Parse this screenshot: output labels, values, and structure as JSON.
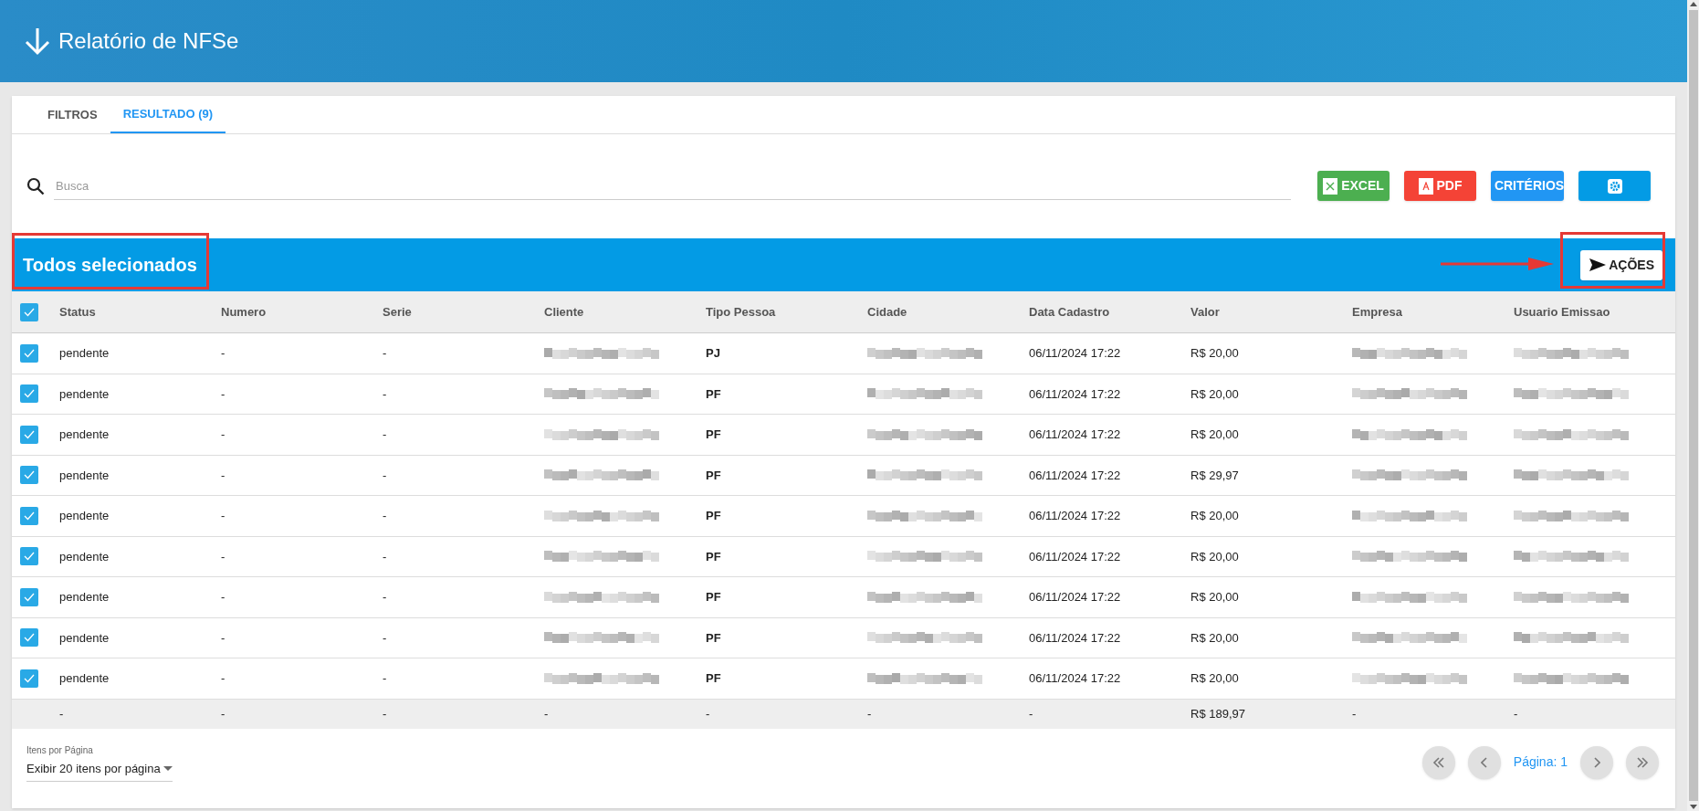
{
  "header": {
    "title": "Relatório de NFSe"
  },
  "tabs": [
    {
      "label": "FILTROS",
      "selected": false
    },
    {
      "label": "RESULTADO (9)",
      "selected": true
    }
  ],
  "search": {
    "placeholder": "Busca"
  },
  "toolbar": [
    {
      "kind": "excel",
      "label": "EXCEL"
    },
    {
      "kind": "pdf",
      "label": "PDF"
    },
    {
      "kind": "criteria",
      "label": "CRITÉRIOS"
    },
    {
      "kind": "settings"
    }
  ],
  "selection_bar": {
    "title": "Todos selecionados",
    "action": "AÇÕES"
  },
  "table": {
    "all_checked": true,
    "columns": [
      "Status",
      "Numero",
      "Serie",
      "Cliente",
      "Tipo Pessoa",
      "Cidade",
      "Data Cadastro",
      "Valor",
      "Empresa",
      "Usuario Emissao"
    ],
    "rows": [
      {
        "checked": true,
        "status": "pendente",
        "numero": "-",
        "serie": "-",
        "tipo": "PJ",
        "data": "06/11/2024 17:22",
        "valor": "R$ 20,00"
      },
      {
        "checked": true,
        "status": "pendente",
        "numero": "-",
        "serie": "-",
        "tipo": "PF",
        "data": "06/11/2024 17:22",
        "valor": "R$ 20,00"
      },
      {
        "checked": true,
        "status": "pendente",
        "numero": "-",
        "serie": "-",
        "tipo": "PF",
        "data": "06/11/2024 17:22",
        "valor": "R$ 20,00"
      },
      {
        "checked": true,
        "status": "pendente",
        "numero": "-",
        "serie": "-",
        "tipo": "PF",
        "data": "06/11/2024 17:22",
        "valor": "R$ 29,97"
      },
      {
        "checked": true,
        "status": "pendente",
        "numero": "-",
        "serie": "-",
        "tipo": "PF",
        "data": "06/11/2024 17:22",
        "valor": "R$ 20,00"
      },
      {
        "checked": true,
        "status": "pendente",
        "numero": "-",
        "serie": "-",
        "tipo": "PF",
        "data": "06/11/2024 17:22",
        "valor": "R$ 20,00"
      },
      {
        "checked": true,
        "status": "pendente",
        "numero": "-",
        "serie": "-",
        "tipo": "PF",
        "data": "06/11/2024 17:22",
        "valor": "R$ 20,00"
      },
      {
        "checked": true,
        "status": "pendente",
        "numero": "-",
        "serie": "-",
        "tipo": "PF",
        "data": "06/11/2024 17:22",
        "valor": "R$ 20,00"
      },
      {
        "checked": true,
        "status": "pendente",
        "numero": "-",
        "serie": "-",
        "tipo": "PF",
        "data": "06/11/2024 17:22",
        "valor": "R$ 20,00"
      }
    ],
    "totals": [
      "-",
      "-",
      "-",
      "-",
      "-",
      "-",
      "-",
      "R$ 189,97",
      "-",
      "-"
    ]
  },
  "pagination": {
    "per_page_label": "Itens por Página",
    "per_page_value": "Exibir 20 itens por página",
    "page": "Página: 1"
  }
}
